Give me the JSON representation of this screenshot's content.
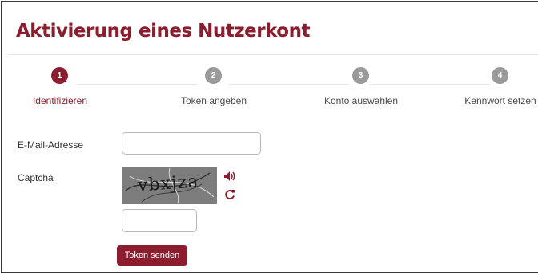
{
  "page": {
    "title": "Aktivierung eines Nutzerkont"
  },
  "steps": [
    {
      "number": "1",
      "label": "Identifizieren",
      "state": "active"
    },
    {
      "number": "2",
      "label": "Token angeben",
      "state": "inactive"
    },
    {
      "number": "3",
      "label": "Konto auswahlen",
      "state": "inactive"
    },
    {
      "number": "4",
      "label": "Kennwort setzen",
      "state": "inactive"
    }
  ],
  "form": {
    "email_label": "E-Mail-Adresse",
    "email_value": "",
    "captcha_label": "Captcha",
    "captcha_image_text": "vbxjza",
    "captcha_value": "",
    "audio_icon": "speaker-icon",
    "refresh_icon": "refresh-icon",
    "submit_label": "Token senden"
  },
  "colors": {
    "brand": "#8c1d2e",
    "step_inactive": "#9a9a9a",
    "captcha_background": "#7d7d7d"
  }
}
